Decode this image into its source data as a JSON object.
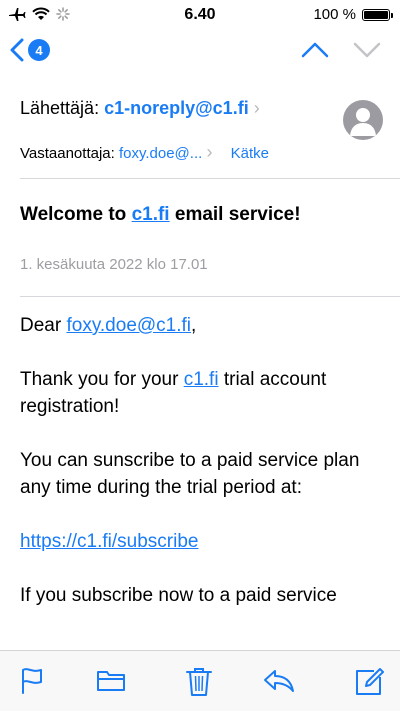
{
  "status_bar": {
    "time": "6.40",
    "battery_percent": "100 %",
    "battery_level": 1.0
  },
  "nav": {
    "unread_count": "4"
  },
  "header": {
    "from_label": "Lähettäjä:",
    "from_address": "c1-noreply@c1.fi",
    "to_label": "Vastaanottaja:",
    "to_address": "foxy.doe@...",
    "hide_label": "Kätke"
  },
  "message": {
    "subject_prefix": "Welcome to ",
    "subject_link": "c1.fi",
    "subject_suffix": " email service!",
    "date": "1. kesäkuuta 2022 klo 17.01",
    "greeting_prefix": "Dear ",
    "greeting_link": "foxy.doe@c1.fi",
    "greeting_suffix": ",",
    "thanks_prefix": "Thank you for your ",
    "thanks_link": "c1.fi",
    "thanks_suffix": " trial account registration!",
    "subscribe_text": "You can sunscribe to a paid service plan any time during the trial period at:",
    "subscribe_link": "https://c1.fi/subscribe",
    "cut_text": "If you subscribe now to a paid service"
  },
  "icons": {
    "status": [
      "airplane-icon",
      "wifi-icon",
      "activity-spinner-icon",
      "battery-icon"
    ],
    "toolbar": [
      "flag-icon",
      "folder-icon",
      "trash-icon",
      "reply-icon",
      "compose-icon"
    ]
  },
  "colors": {
    "accent": "#1a7cf5",
    "secondary_text": "#9d9da3",
    "divider": "#d8d8dc"
  }
}
